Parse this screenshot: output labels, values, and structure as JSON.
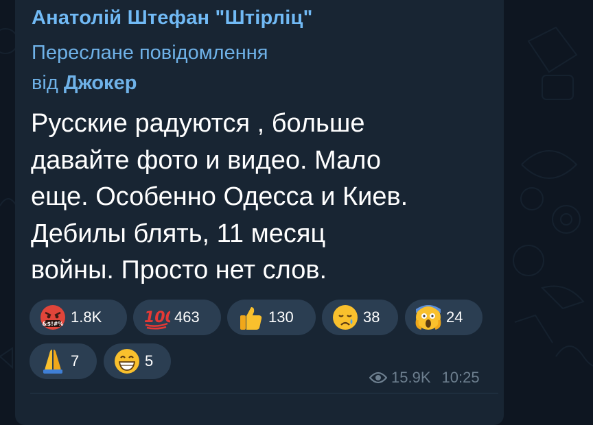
{
  "message": {
    "author": "Анатолій Штефан \"Штірліц\"",
    "forwarded_label": "Переслане повідомлення",
    "forwarded_from_prefix": "від",
    "forwarded_from_name": "Джокер",
    "text_lines": [
      "Русские радуются , больше",
      "давайте фото и видео. Мало",
      "еще. Особенно Одесса и Киев.",
      "Дебилы блять, 11 месяц",
      "войны. Просто нет слов."
    ],
    "reactions": [
      {
        "emoji": "cursing-face-icon",
        "count": "1.8K"
      },
      {
        "emoji": "hundred-points-icon",
        "count": "463"
      },
      {
        "emoji": "thumbs-up-icon",
        "count": "130"
      },
      {
        "emoji": "crying-face-icon",
        "count": "38"
      },
      {
        "emoji": "screaming-face-icon",
        "count": "24"
      },
      {
        "emoji": "folded-hands-icon",
        "count": "7"
      },
      {
        "emoji": "grinning-face-icon",
        "count": "5"
      }
    ],
    "views": "15.9K",
    "time": "10:25"
  },
  "colors": {
    "background": "#0e1621",
    "bubble": "#182533",
    "author": "#71baf5",
    "reaction_chip": "#2b3e52",
    "meta": "#6d7f8f"
  }
}
